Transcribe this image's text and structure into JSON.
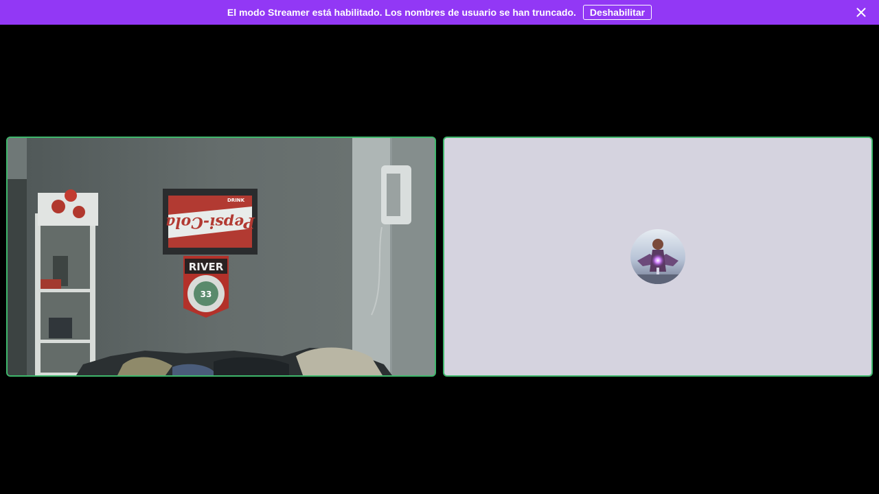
{
  "banner": {
    "message": "El modo Streamer está habilitado. Los nombres de usuario se han truncado.",
    "disable_label": "Deshabilitar",
    "background_color": "#9238f5",
    "close_icon": "close-icon"
  },
  "call": {
    "speaking_border_color": "#3fb86c",
    "tiles": [
      {
        "kind": "camera-video"
      },
      {
        "kind": "avatar",
        "background_color": "#d5d3df"
      }
    ],
    "poster": {
      "top_text": "DRINK",
      "logo_text": "Pepsi-Cola"
    },
    "flag": {
      "text": "RIVER",
      "badge_number": "33"
    }
  }
}
